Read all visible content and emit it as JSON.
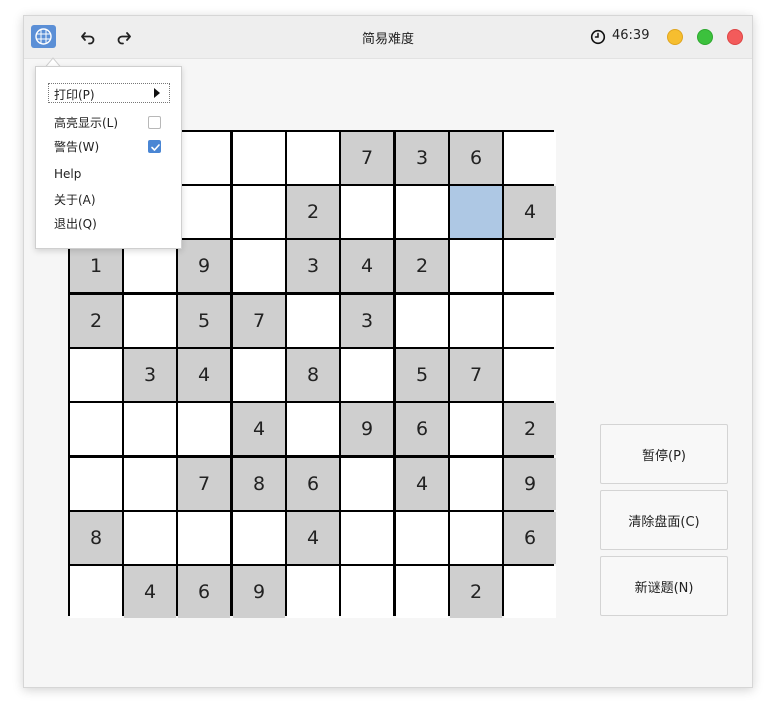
{
  "window": {
    "title": "简易难度"
  },
  "toolbar": {
    "undo_icon": "undo-icon",
    "redo_icon": "redo-icon"
  },
  "timer": {
    "value": "46:39",
    "icon": "clock-icon"
  },
  "window_controls": {
    "minimize_color": "#f6be2f",
    "maximize_color": "#3cc13d",
    "close_color": "#f35b5b"
  },
  "menu": {
    "print": "打印(P)",
    "highlight": "高亮显示(L)",
    "highlight_checked": false,
    "warnings": "警告(W)",
    "warnings_checked": true,
    "help": "Help",
    "about": "关于(A)",
    "quit": "退出(Q)"
  },
  "buttons": {
    "pause": "暂停(P)",
    "clear": "清除盘面(C)",
    "new_puzzle": "新谜题(N)"
  },
  "board": {
    "rows": [
      [
        "",
        "",
        "",
        "",
        "",
        "7",
        "3",
        "6",
        ""
      ],
      [
        "",
        "",
        "",
        "",
        "2",
        "",
        "",
        "",
        "4"
      ],
      [
        "1",
        "",
        "9",
        "",
        "3",
        "4",
        "2",
        "",
        ""
      ],
      [
        "2",
        "",
        "5",
        "7",
        "",
        "3",
        "",
        "",
        ""
      ],
      [
        "",
        "3",
        "4",
        "",
        "8",
        "",
        "5",
        "7",
        ""
      ],
      [
        "",
        "",
        "",
        "4",
        "",
        "9",
        "6",
        "",
        "2"
      ],
      [
        "",
        "",
        "7",
        "8",
        "6",
        "",
        "4",
        "",
        "9"
      ],
      [
        "8",
        "",
        "",
        "",
        "4",
        "",
        "",
        "",
        "6"
      ],
      [
        "",
        "4",
        "6",
        "9",
        "",
        "",
        "",
        "2",
        ""
      ]
    ],
    "selected": [
      1,
      7
    ],
    "given_color": "#cfcfcf",
    "selected_color": "#aec8e4"
  }
}
